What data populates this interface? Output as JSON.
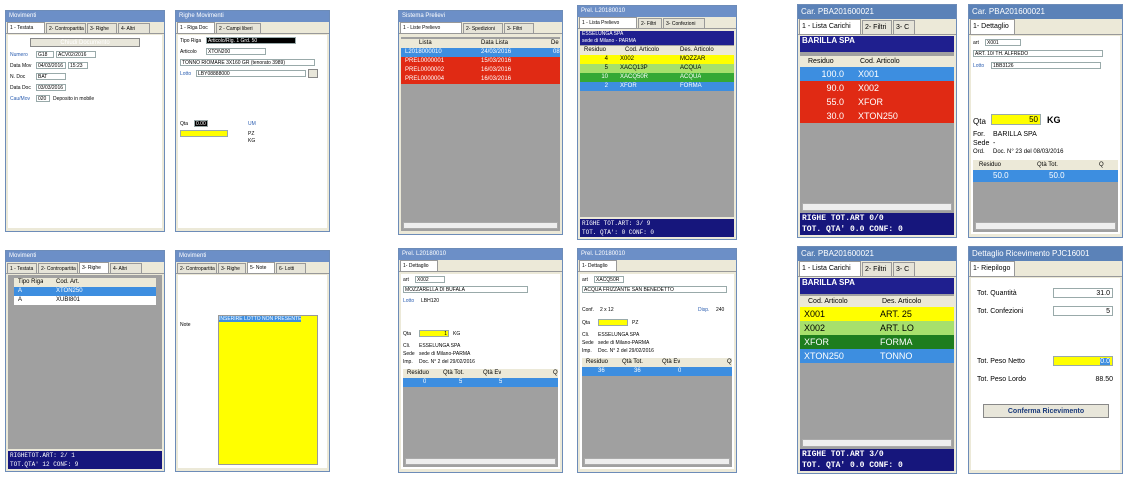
{
  "colors": {
    "titlebar": "#6c8fc7",
    "navy": "#16167c",
    "red": "#e02a14",
    "yellow": "#ffff00",
    "green": "#35a835",
    "dark_green": "#1e7d1e",
    "light_green": "#a7e06c",
    "selection_blue": "#3d8ee0",
    "gray": "#a0a0a0"
  },
  "g1": {
    "a": {
      "title": "Movimenti",
      "tabs": [
        "1 - Testata",
        "2- Contropartita",
        "3- Righe",
        "4- Altri"
      ],
      "button": "Chiudi Documento",
      "rows": [
        {
          "label": "Numero",
          "value": "G18",
          "extra": "ACV02/2016"
        },
        {
          "label": "Data Mov",
          "value": "04/03/2016",
          "extra": "15:23"
        },
        {
          "label": "N. Doc",
          "value": "BAT",
          "extra": ""
        },
        {
          "label": "Data Doc",
          "value": "03/03/2016",
          "extra": ""
        },
        {
          "label": "Cau/Mov",
          "value": "020",
          "extra": "Deposito in mobile"
        }
      ]
    },
    "b": {
      "title": "Righe Movimenti",
      "tabs": [
        "1 - Riga Doc",
        "2 - Campi liberi"
      ],
      "tipo_label": "Tipo Riga",
      "tipo_value": "Articolo/Rig. 1 Grd. 50",
      "articolo_label": "Articolo",
      "articolo_value": "XTON200",
      "desc": "TONNO RIOMARE 3X160 GR (tenorato 3989)",
      "lotto_label": "Lotto",
      "lotto_value": "LBY08888000",
      "qta_label": "Qta",
      "qta_value": "0.00",
      "um_label": "UM",
      "um1": "PZ",
      "um2": "KG"
    },
    "c": {
      "title": "Movimenti",
      "tabs": [
        "1 - Testata",
        "2- Contropartita",
        "3- Righe",
        "4- Altri"
      ],
      "cols": [
        "Tipo Riga",
        "Cod. Art."
      ],
      "rows": [
        {
          "tipo": "A",
          "art": "XTON250"
        },
        {
          "tipo": "A",
          "art": "XUBI801"
        }
      ],
      "footer1": "RIGHETOT.ART:   2/ 1",
      "footer2": "TOT.QTA' 12  CONF: 9"
    },
    "d": {
      "title": "Movimenti",
      "tabs": [
        "2- Contropartita",
        "3- Righe",
        "5- Note",
        "6- Lotti"
      ],
      "note_label": "Note",
      "note_value": "INSERIRE LOTTO NON PRESENTE"
    }
  },
  "g2": {
    "a": {
      "title": "Sistema Prelievi",
      "tabs": [
        "1 - Liste Prelievo",
        "2- Spedizioni",
        "3- Filtri"
      ],
      "cols": [
        "Lista",
        "Data Lista",
        "De"
      ],
      "rows": [
        {
          "lista": "L2018000010",
          "data": "24/03/2016",
          "de": "08",
          "color": "blue"
        },
        {
          "lista": "PREL0000001",
          "data": "15/03/2016",
          "de": "",
          "color": "red"
        },
        {
          "lista": "PREL0000002",
          "data": "16/03/2016",
          "de": "",
          "color": "red"
        },
        {
          "lista": "PREL0000004",
          "data": "16/03/2016",
          "de": "",
          "color": "red"
        }
      ]
    },
    "b": {
      "title": "Prel. L20180010",
      "tabs": [
        "1 - Lista Prelievo",
        "2- Filtri",
        "3- Confezioni"
      ],
      "cliente1": "ESSELUNGA SPA",
      "cliente2": "sede di Milano - PARMA",
      "cols": [
        "Residuo",
        "Cod. Articolo",
        "Des. Articolo"
      ],
      "rows": [
        {
          "res": "4",
          "cod": "X002",
          "des": "MOZZAR",
          "color": "yellow"
        },
        {
          "res": "5",
          "cod": "XACQ13P",
          "des": "ACQUA",
          "color": "light_green"
        },
        {
          "res": "10",
          "cod": "XACQ50R",
          "des": "ACQUA",
          "color": "green"
        },
        {
          "res": "2",
          "cod": "XFOR",
          "des": "FORMA",
          "color": "selection_blue"
        }
      ],
      "footer1": "RIGHE TOT.ART:    3/ 9",
      "footer2": "TOT. QTA': 0  CONF: 0"
    },
    "c": {
      "title": "Prel. L20180010",
      "tab": "1- Dettaglio",
      "art_label": "art",
      "art_value": "X002",
      "desc": "MOZZARELLA DI BUFALA",
      "lotto_label": "Lotto",
      "lotto_value": "LBH120",
      "qta_label": "Qta",
      "qta_value": "1",
      "um": "KG",
      "cli_label": "Cli.",
      "cli_value": "ESSELUNGA SPA",
      "sede_label": "Sede",
      "sede_value": "sede di Milano-PARMA",
      "imp_label": "Imp.",
      "imp_value": "Doc. N° 2 del 29/02/2016",
      "cols": [
        "Residuo",
        "Qtà Tot.",
        "Qtà Ev",
        "Q"
      ],
      "row": [
        "0",
        "5",
        "5"
      ]
    },
    "d": {
      "title": "Prel. L20180010",
      "tab": "1- Dettaglio",
      "art_label": "art",
      "art_value": "XACQ50R",
      "desc": "ACQUA FRIZZANTE SAN BENEDETTO",
      "conf_label": "Conf.",
      "conf_value": "2 x 12",
      "qta_label": "Qta",
      "qta_value": "",
      "um": "PZ",
      "disp_label": "Disp.",
      "disp_value": "240",
      "cli_label": "Cli.",
      "cli_value": "ESSELUNGA SPA",
      "sede_label": "Sede",
      "sede_value": "sede di Milano-PARMA",
      "imp_label": "Imp.",
      "imp_value": "Doc. N° 2 del 29/02/2016",
      "cols": [
        "Residuo",
        "Qtà Tot.",
        "Qtà Ev",
        "Q"
      ],
      "row": [
        "36",
        "36",
        "0"
      ]
    }
  },
  "g3": {
    "a": {
      "title": "Car. PBA201600021",
      "tabs": [
        "1 - Lista Carichi",
        "2- Filtri",
        "3- C"
      ],
      "supplier": "BARILLA SPA",
      "cols": [
        "Residuo",
        "Cod. Articolo"
      ],
      "rows": [
        {
          "res": "100.0",
          "cod": "X001",
          "color": "selection_blue"
        },
        {
          "res": "90.0",
          "cod": "X002",
          "color": "red"
        },
        {
          "res": "55.0",
          "cod": "XFOR",
          "color": "red"
        },
        {
          "res": "30.0",
          "cod": "XTON250",
          "color": "red"
        }
      ],
      "footer1": "RIGHE TOT.ART   0/0",
      "footer2": "TOT. QTA' 0.0  CONF: 0"
    },
    "b": {
      "title": "Car. PBA201600021",
      "tab": "1- Dettaglio",
      "art_label": "art",
      "art_value": "X001",
      "desc": "ART. 10/ TH. ALFREDO",
      "lotto_label": "Lotto",
      "lotto_value": "1BB3126",
      "qta_label": "Qta",
      "qta_value": "50",
      "um": "KG",
      "for_label": "For.",
      "for_value": "BARILLA SPA",
      "sede_label": "Sede",
      "sede_value": "-",
      "ord_label": "Ord.",
      "ord_value": "Doc. N° 23 del 08/03/2016",
      "cols": [
        "Residuo",
        "Qtà Tot.",
        "Q"
      ],
      "row": [
        "50.0",
        "50.0"
      ]
    },
    "c": {
      "title": "Car. PBA201600021",
      "tabs": [
        "1 - Lista Carichi",
        "2- Filtri",
        "3- C"
      ],
      "supplier": "BARILLA SPA",
      "cols": [
        "Cod. Articolo",
        "Des. Articolo"
      ],
      "rows": [
        {
          "cod": "X001",
          "des": "ART. 25",
          "color": "yellow"
        },
        {
          "cod": "X002",
          "des": "ART. LO",
          "color": "light_green"
        },
        {
          "cod": "XFOR",
          "des": "FORMA",
          "color": "dark_green"
        },
        {
          "cod": "XTON250",
          "des": "TONNO",
          "color": "selection_blue"
        }
      ],
      "footer1": "RIGHE TOT.ART   3/0",
      "footer2": "TOT. QTA' 0.0  CONF: 0"
    },
    "d": {
      "title": "Dettaglio Ricevimento PJC16001",
      "tab": "1- Riepilogo",
      "rows": [
        {
          "label": "Tot. Quantità",
          "value": "31.0"
        },
        {
          "label": "Tot. Confezioni",
          "value": "5"
        },
        {
          "label": "Tot. Peso Netto",
          "value": "0.0"
        },
        {
          "label": "Tot. Peso Lordo",
          "value": "88.50"
        }
      ],
      "button": "Conferma Ricevimento"
    }
  }
}
